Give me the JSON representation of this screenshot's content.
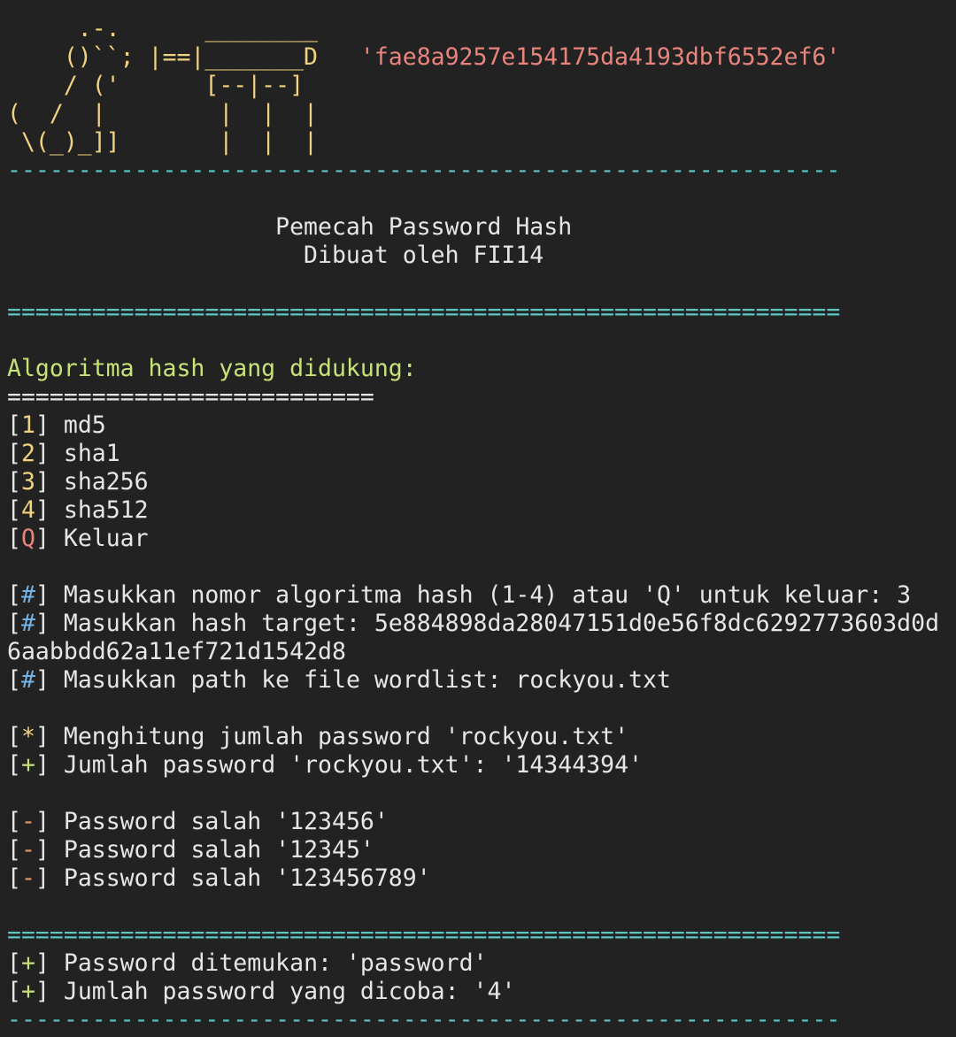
{
  "banner": {
    "art": [
      "     .-.      ________",
      "    ()``; |==|_______D",
      "    / ('      [--|--]",
      "(  /  |        |  |  |",
      " \\(_)_]]       |  |  |"
    ],
    "hash": "'fae8a9257e154175da4193dbf6552ef6'",
    "dashes": "-----------------------------------------------------------"
  },
  "title": {
    "line1": "                   Pemecah Password Hash",
    "line2": "                     Dibuat oleh FII14"
  },
  "separator_long": "===========================================================",
  "menu": {
    "heading": "Algoritma hash yang didukung:",
    "underline": "==========================",
    "items": [
      {
        "key": "1",
        "label": "md5"
      },
      {
        "key": "2",
        "label": "sha1"
      },
      {
        "key": "3",
        "label": "sha256"
      },
      {
        "key": "4",
        "label": "sha512"
      },
      {
        "key": "Q",
        "label": "Keluar"
      }
    ]
  },
  "prompts": {
    "symbol": "#",
    "algo": "Masukkan nomor algoritma hash (1-4) atau 'Q' untuk keluar: 3",
    "hash": "Masukkan hash target: 5e884898da28047151d0e56f8dc6292773603d0d",
    "hash_cont": "6aabbdd62a11ef721d1542d8",
    "wordlist": "Masukkan path ke file wordlist: rockyou.txt"
  },
  "status": {
    "counting_symbol": "*",
    "counting": "Menghitung jumlah password 'rockyou.txt'",
    "total_symbol": "+",
    "total": "Jumlah password 'rockyou.txt': '14344394'"
  },
  "attempts": {
    "symbol": "-",
    "items": [
      "Password salah '123456'",
      "Password salah '12345'",
      "Password salah '123456789'"
    ]
  },
  "result": {
    "symbol": "+",
    "found": "Password ditemukan: 'password'",
    "tried": "Jumlah password yang dicoba: '4'"
  },
  "bracket_open": "[",
  "bracket_close": "] "
}
